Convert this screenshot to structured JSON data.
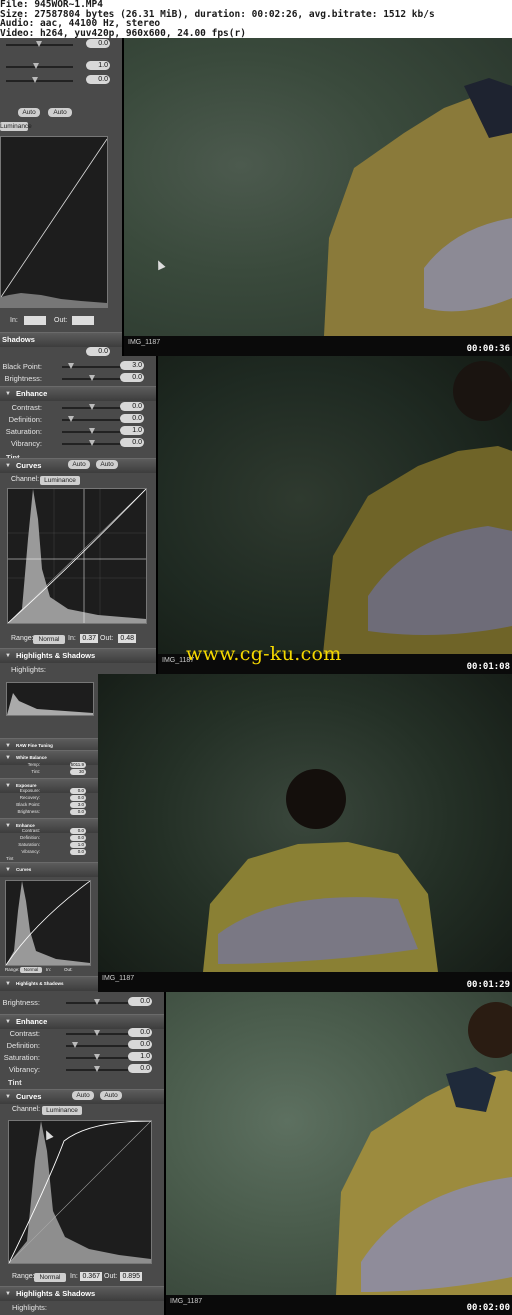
{
  "header": {
    "file": "File: 945WOR~1.MP4",
    "size": "Size: 27587804 bytes (26.31 MiB), duration: 00:02:26, avg.bitrate: 1512 kb/s",
    "audio": "Audio: aac, 44100 Hz, stereo",
    "video": "Video: h264, yuv420p, 960x600, 24.00 fps(r)"
  },
  "watermark": "www.cg-ku.com",
  "frames": [
    {
      "timestamp": "00:00:36",
      "caption": "IMG_1187",
      "slider_values": [
        "0.0",
        "1.0",
        "0.0"
      ],
      "curves_buttons": [
        "Auto",
        "Auto"
      ],
      "channel_value": "Luminance",
      "in_label": "In:",
      "out_label": "Out:",
      "shadows_label": "Shadows",
      "bottom_value": "0.0"
    },
    {
      "timestamp": "00:01:08",
      "caption": "IMG_1187",
      "black_point": {
        "label": "Black Point:",
        "value": "3.0"
      },
      "brightness": {
        "label": "Brightness:",
        "value": "0.0"
      },
      "enhance": {
        "title": "Enhance",
        "rows": [
          {
            "label": "Contrast:",
            "value": "0.0"
          },
          {
            "label": "Definition:",
            "value": "0.0"
          },
          {
            "label": "Saturation:",
            "value": "1.0"
          },
          {
            "label": "Vibrancy:",
            "value": "0.0"
          }
        ],
        "tint": "Tint"
      },
      "curves": {
        "title": "Curves",
        "auto1": "Auto",
        "auto2": "Auto",
        "channel_label": "Channel:",
        "channel_value": "Luminance",
        "range_label": "Range:",
        "range_value": "Normal",
        "in_label": "In:",
        "in_value": "0.37",
        "out_label": "Out:",
        "out_value": "0.48"
      },
      "highlights": "Highlights & Shadows",
      "highlights_sub": "Highlights:"
    },
    {
      "timestamp": "00:01:29",
      "caption": "IMG_1187",
      "sections": {
        "raw": "RAW Fine Tuning",
        "white_balance": "White Balance",
        "temp": "Temp:",
        "temp_value": "5011.9",
        "tint": "Tint:",
        "tint_value": "30",
        "exposure": "Exposure",
        "exposure_rows": [
          "Exposure:",
          "Recovery:",
          "Black Point:",
          "Brightness:"
        ],
        "exposure_values": [
          "0.0",
          "0.0",
          "3.0",
          "0.0"
        ],
        "enhance": "Enhance",
        "enhance_rows": [
          "Contrast:",
          "Definition:",
          "Saturation:",
          "Vibrancy:"
        ],
        "enhance_values": [
          "0.0",
          "0.0",
          "1.0",
          "0.0"
        ],
        "tint_section": "Tint",
        "curves": "Curves",
        "highlights": "Highlights & Shadows",
        "range": "Range:",
        "range_value": "Normal",
        "in_label": "In:",
        "out_label": "Out:"
      }
    },
    {
      "timestamp": "00:02:00",
      "caption": "IMG_1187",
      "brightness": {
        "label": "Brightness:",
        "value": "0.0"
      },
      "enhance": {
        "title": "Enhance",
        "rows": [
          {
            "label": "Contrast:",
            "value": "0.0"
          },
          {
            "label": "Definition:",
            "value": "0.0"
          },
          {
            "label": "Saturation:",
            "value": "1.0"
          },
          {
            "label": "Vibrancy:",
            "value": "0.0"
          }
        ],
        "tint": "Tint"
      },
      "curves": {
        "title": "Curves",
        "auto1": "Auto",
        "auto2": "Auto",
        "channel_label": "Channel:",
        "channel_value": "Luminance",
        "range_label": "Range:",
        "range_value": "Normal",
        "in_label": "In:",
        "in_value": "0.367",
        "out_label": "Out:",
        "out_value": "0.895"
      },
      "highlights": "Highlights & Shadows",
      "highlights_sub": "Highlights:"
    }
  ],
  "colors": {
    "panel": "#4a4a4a",
    "watermark": "#f5d800",
    "timestamp": "#ffffff"
  }
}
